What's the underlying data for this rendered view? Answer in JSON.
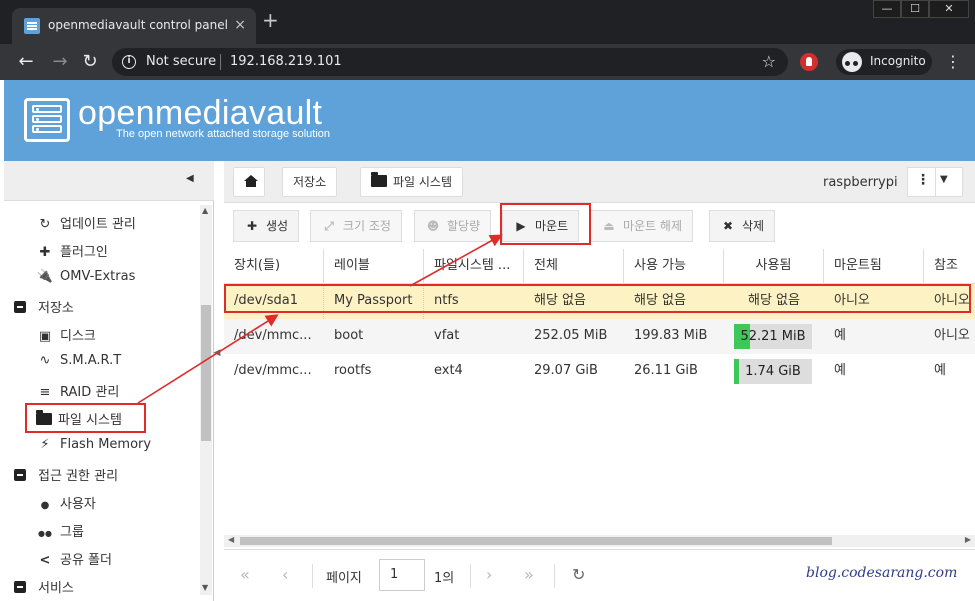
{
  "browser": {
    "tab_title": "openmediavault control panel - r",
    "tab_close": "×",
    "new_tab": "+",
    "win_min": "—",
    "win_max": "☐",
    "win_close": "✕",
    "back": "←",
    "forward": "→",
    "reload": "↻",
    "not_secure": "Not secure",
    "url": "192.168.219.101",
    "incognito": "Incognito",
    "menu": "⋮",
    "star": "☆"
  },
  "header": {
    "title": "openmediavault",
    "subtitle": "The open network attached storage solution",
    "brand_color": "#5ea2d9"
  },
  "sidebar": {
    "items": [
      {
        "label": "업데이트 관리",
        "icon": "↻"
      },
      {
        "label": "플러그인",
        "icon": "✚"
      },
      {
        "label": "OMV-Extras",
        "icon": "🔌"
      },
      {
        "label": "저장소"
      },
      {
        "label": "디스크",
        "icon": "▣"
      },
      {
        "label": "S.M.A.R.T",
        "icon": "∿"
      },
      {
        "label": "RAID 관리",
        "icon": "≡"
      },
      {
        "label": "파일 시스템"
      },
      {
        "label": "Flash Memory",
        "icon": "⚡"
      },
      {
        "label": "접근 권한 관리"
      },
      {
        "label": "사용자",
        "icon": "●"
      },
      {
        "label": "그룹",
        "icon": "●●"
      },
      {
        "label": "공유 폴더",
        "icon": "<"
      },
      {
        "label": "서비스"
      }
    ]
  },
  "breadcrumb": {
    "storage": "저장소",
    "filesystems": "파일 시스템",
    "host": "raspberrypi"
  },
  "toolbar": {
    "create": "생성",
    "resize": "크기 조정",
    "quota": "할당량",
    "mount": "마운트",
    "unmount": "마운트 해제",
    "delete": "삭제"
  },
  "grid": {
    "columns": [
      "장치(들)",
      "레이블",
      "파일시스템 ...",
      "전체",
      "사용 가능",
      "사용됨",
      "마운트됨",
      "참조"
    ],
    "rows": [
      {
        "device": "/dev/sda1",
        "label": "My Passport",
        "fs": "ntfs",
        "total": "해당 없음",
        "available": "해당 없음",
        "used": "해당 없음",
        "used_pct": null,
        "mounted": "아니오",
        "referenced": "아니오"
      },
      {
        "device": "/dev/mmc...",
        "label": "boot",
        "fs": "vfat",
        "total": "252.05 MiB",
        "available": "199.83 MiB",
        "used": "52.21 MiB",
        "used_pct": 0.21,
        "mounted": "예",
        "referenced": "아니오"
      },
      {
        "device": "/dev/mmc...",
        "label": "rootfs",
        "fs": "ext4",
        "total": "29.07 GiB",
        "available": "26.11 GiB",
        "used": "1.74 GiB",
        "used_pct": 0.06,
        "mounted": "예",
        "referenced": "예"
      }
    ]
  },
  "pager": {
    "page_label": "페이지",
    "page_value": "1",
    "of_label": "1의"
  },
  "watermark": "blog.codesarang.com",
  "colors": {
    "highlight": "#e02b2b",
    "selected_row": "#fdf2c4",
    "usage_bar": "#3cc85a"
  }
}
